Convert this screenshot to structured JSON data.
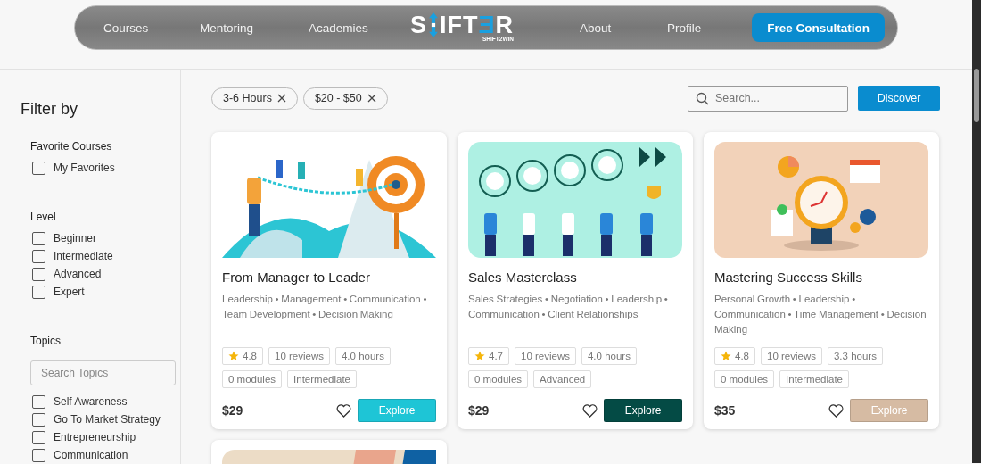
{
  "nav": {
    "links": [
      {
        "label": "Courses"
      },
      {
        "label": "Mentoring"
      },
      {
        "label": "Academies"
      }
    ],
    "logo": {
      "first": "S",
      "middle": "IFT",
      "accent": "Ǝ",
      "last": "R",
      "tagline": "SHIFT2WIN"
    },
    "right_links": [
      {
        "label": "About"
      },
      {
        "label": "Profile"
      }
    ],
    "cta": "Free Consultation"
  },
  "sidebar": {
    "title": "Filter by",
    "sections": [
      {
        "heading": "Favorite Courses",
        "options": [
          {
            "label": "My Favorites",
            "checked": false
          }
        ]
      },
      {
        "heading": "Level",
        "options": [
          {
            "label": "Beginner",
            "checked": false
          },
          {
            "label": "Intermediate",
            "checked": false
          },
          {
            "label": "Advanced",
            "checked": false
          },
          {
            "label": "Expert",
            "checked": false
          }
        ]
      },
      {
        "heading": "Topics",
        "search_placeholder": "Search Topics",
        "options": [
          {
            "label": "Self Awareness",
            "checked": false
          },
          {
            "label": "Go To Market Strategy",
            "checked": false
          },
          {
            "label": "Entrepreneurship",
            "checked": false
          },
          {
            "label": "Communication",
            "checked": false
          }
        ]
      }
    ]
  },
  "filters": [
    {
      "label": "3-6 Hours"
    },
    {
      "label": "$20 - $50"
    }
  ],
  "search": {
    "placeholder": "Search..."
  },
  "discover": "Discover",
  "courses": [
    {
      "kind": "full",
      "title": "From Manager to Leader",
      "topics": "Leadership • Management • Communication • Team Development • Decision Making",
      "rating": "4.8",
      "reviews": "10 reviews",
      "hours": "4.0 hours",
      "modules": "0 modules",
      "level": "Intermediate",
      "price": "$29",
      "button": "Explore",
      "color": "#1ec5d6"
    },
    {
      "kind": "full",
      "title": "Sales Masterclass",
      "topics": "Sales Strategies • Negotiation • Leadership • Communication • Client Relationships",
      "rating": "4.7",
      "reviews": "10 reviews",
      "hours": "4.0 hours",
      "modules": "0 modules",
      "level": "Advanced",
      "price": "$29",
      "button": "Explore",
      "color": "#044b45"
    },
    {
      "kind": "full",
      "title": "Mastering Success Skills",
      "topics": "Personal Growth • Leadership • Communication • Time Management • Decision Making",
      "rating": "4.8",
      "reviews": "10 reviews",
      "hours": "3.3 hours",
      "modules": "0 modules",
      "level": "Intermediate",
      "price": "$35",
      "button": "Explore",
      "color": "#d6bba3"
    },
    {
      "kind": "picture"
    }
  ]
}
